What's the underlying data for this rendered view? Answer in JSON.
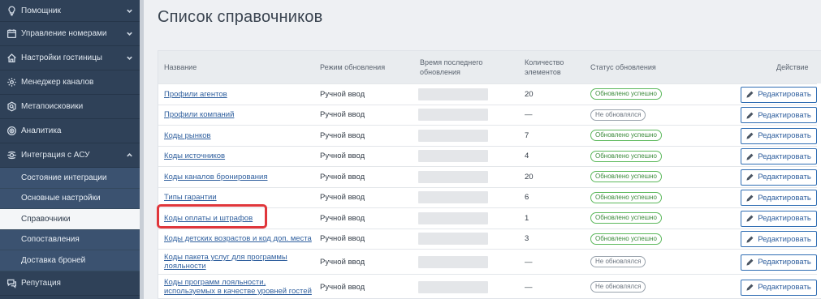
{
  "sidebar": {
    "items": [
      {
        "label": "Помощник",
        "icon": "lightbulb-icon",
        "expanded": false
      },
      {
        "label": "Управление номерами",
        "icon": "calendar-icon",
        "expanded": false
      },
      {
        "label": "Настройки гостиницы",
        "icon": "home-icon",
        "expanded": false
      },
      {
        "label": "Менеджер каналов",
        "icon": "gear-icon"
      },
      {
        "label": "Метапоисковики",
        "icon": "search-icon"
      },
      {
        "label": "Аналитика",
        "icon": "analytics-icon"
      },
      {
        "label": "Интеграция с АСУ",
        "icon": "integration-icon",
        "expanded": true
      },
      {
        "label": "Репутация",
        "icon": "chat-icon"
      }
    ],
    "subitems": [
      {
        "label": "Состояние интеграции"
      },
      {
        "label": "Основные настройки"
      },
      {
        "label": "Справочники",
        "active": true
      },
      {
        "label": "Сопоставления"
      },
      {
        "label": "Доставка броней"
      }
    ]
  },
  "page": {
    "title": "Список справочников"
  },
  "table": {
    "headers": {
      "name": "Название",
      "mode": "Режим обновления",
      "time": "Время последнего обновления",
      "count": "Количество элементов",
      "status": "Статус обновления",
      "action": "Действие"
    },
    "edit_label": "Редактировать",
    "rows": [
      {
        "name": "Профили агентов",
        "mode": "Ручной ввод",
        "count": "20",
        "status": "Обновлено успешно",
        "ok": true
      },
      {
        "name": "Профили компаний",
        "mode": "Ручной ввод",
        "count": "—",
        "status": "Не обновлялся",
        "ok": false
      },
      {
        "name": "Коды рынков",
        "mode": "Ручной ввод",
        "count": "7",
        "status": "Обновлено успешно",
        "ok": true
      },
      {
        "name": "Коды источников",
        "mode": "Ручной ввод",
        "count": "4",
        "status": "Обновлено успешно",
        "ok": true
      },
      {
        "name": "Коды каналов бронирования",
        "mode": "Ручной ввод",
        "count": "20",
        "status": "Обновлено успешно",
        "ok": true
      },
      {
        "name": "Типы гарантии",
        "mode": "Ручной ввод",
        "count": "6",
        "status": "Обновлено успешно",
        "ok": true
      },
      {
        "name": "Коды оплаты и штрафов",
        "mode": "Ручной ввод",
        "count": "1",
        "status": "Обновлено успешно",
        "ok": true
      },
      {
        "name": "Коды детских возрастов и код доп. места",
        "mode": "Ручной ввод",
        "count": "3",
        "status": "Обновлено успешно",
        "ok": true
      },
      {
        "name": "Коды пакета услуг для программы лояльности",
        "mode": "Ручной ввод",
        "count": "—",
        "status": "Не обновлялся",
        "ok": false
      },
      {
        "name": "Коды программ лояльности, используемых в качестве уровней гостей",
        "mode": "Ручной ввод",
        "count": "—",
        "status": "Не обновлялся",
        "ok": false
      }
    ]
  },
  "colors": {
    "sidebar": "#2f4158",
    "sidebar_sub": "#3b5270",
    "link": "#2f5f9e",
    "ok_badge": "#5cb85c",
    "highlight": "#e0363b"
  }
}
